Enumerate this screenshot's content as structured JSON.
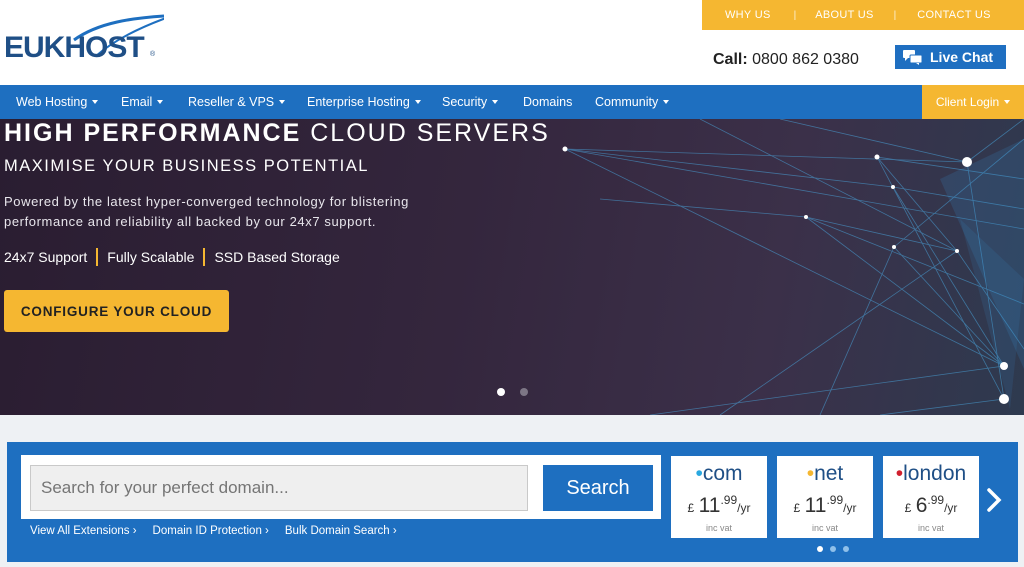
{
  "brand": {
    "logo_text": "EUKHOST",
    "registered_mark": "®"
  },
  "colors": {
    "primary_blue": "#1e6fc0",
    "accent_yellow": "#f5b731",
    "hero_dark": "#2a1d31"
  },
  "utility_nav": [
    {
      "label": "WHY US"
    },
    {
      "label": "ABOUT US"
    },
    {
      "label": "CONTACT US"
    }
  ],
  "contact": {
    "call_label": "Call:",
    "phone": "0800 862 0380"
  },
  "live_chat": {
    "label": "Live Chat",
    "icon": "chat-bubbles-icon"
  },
  "main_nav": [
    {
      "label": "Web Hosting",
      "dropdown": true
    },
    {
      "label": "Email",
      "dropdown": true
    },
    {
      "label": "Reseller & VPS",
      "dropdown": true
    },
    {
      "label": "Enterprise Hosting",
      "dropdown": true
    },
    {
      "label": "Security",
      "dropdown": true
    },
    {
      "label": "Domains",
      "dropdown": false
    },
    {
      "label": "Community",
      "dropdown": true
    }
  ],
  "client_login": {
    "label": "Client Login",
    "dropdown": true
  },
  "hero": {
    "title_bold": "HIGH PERFORMANCE",
    "title_light": "CLOUD SERVERS",
    "subtitle": "MAXIMISE YOUR BUSINESS POTENTIAL",
    "description": "Powered by the latest hyper-converged technology for blistering performance and reliability all backed by our 24x7 support.",
    "features": [
      "24x7 Support",
      "Fully Scalable",
      "SSD Based Storage"
    ],
    "cta_label": "CONFIGURE YOUR CLOUD",
    "slides": {
      "count": 2,
      "active": 1
    }
  },
  "domain_search": {
    "placeholder": "Search for your perfect domain...",
    "button_label": "Search",
    "links": [
      "View All Extensions ›",
      "Domain ID Protection ›",
      "Bulk Domain Search ›"
    ],
    "tlds": [
      {
        "dot": "•",
        "name": "com",
        "dot_color": "#29a8e0",
        "currency": "£",
        "price_int": "11",
        "price_dec": ".99",
        "per": "/yr",
        "vat": "inc vat"
      },
      {
        "dot": "•",
        "name": "net",
        "dot_color": "#f5b731",
        "currency": "£",
        "price_int": "11",
        "price_dec": ".99",
        "per": "/yr",
        "vat": "inc vat"
      },
      {
        "dot": "•",
        "name": "london",
        "dot_color": "#d0202e",
        "currency": "£",
        "price_int": "6",
        "price_dec": ".99",
        "per": "/yr",
        "vat": "inc vat"
      }
    ],
    "carousel": {
      "count": 3,
      "active": 1
    }
  }
}
